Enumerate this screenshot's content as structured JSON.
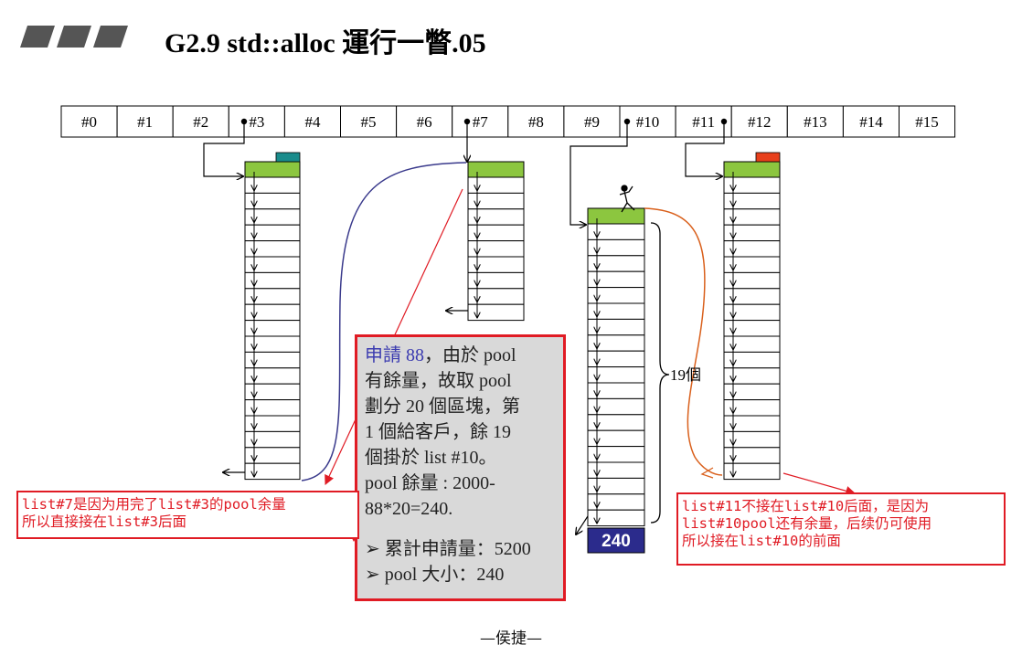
{
  "title": "G2.9 std::alloc 運行一瞥.05",
  "free_list_slots": [
    "#0",
    "#1",
    "#2",
    "#3",
    "#4",
    "#5",
    "#6",
    "#7",
    "#8",
    "#9",
    "#10",
    "#11",
    "#12",
    "#13",
    "#14",
    "#15"
  ],
  "pool_label": "240",
  "brace_label": "19個",
  "info_box": {
    "line1_req": "申請 88",
    "line1_rest": "，由於 pool",
    "line2": "有餘量，故取 pool",
    "line3": "劃分 20 個區塊，第",
    "line4": "1 個給客戶，餘 19",
    "line5": "個掛於 list #10。",
    "line6": "pool 餘量 : 2000-",
    "line7": "88*20=240.",
    "bullet1": "累計申請量：5200",
    "bullet2": "pool 大小：240"
  },
  "note_left": "list#7是因为用完了list#3的pool余量\n所以直接接在list#3后面",
  "note_right": "list#11不接在list#10后面，是因为\nlist#10pool还有余量，后续仍可使用\n所以接在list#10的前面",
  "footer": "—侯捷—",
  "colors": {
    "green": "#8cc63f",
    "teal": "#1a8c8c",
    "orange": "#e8401c",
    "pool_blue": "#2b2b8c",
    "red": "#e01b24",
    "purple": "#3a3a8c",
    "curve_orange": "#d9601c"
  }
}
